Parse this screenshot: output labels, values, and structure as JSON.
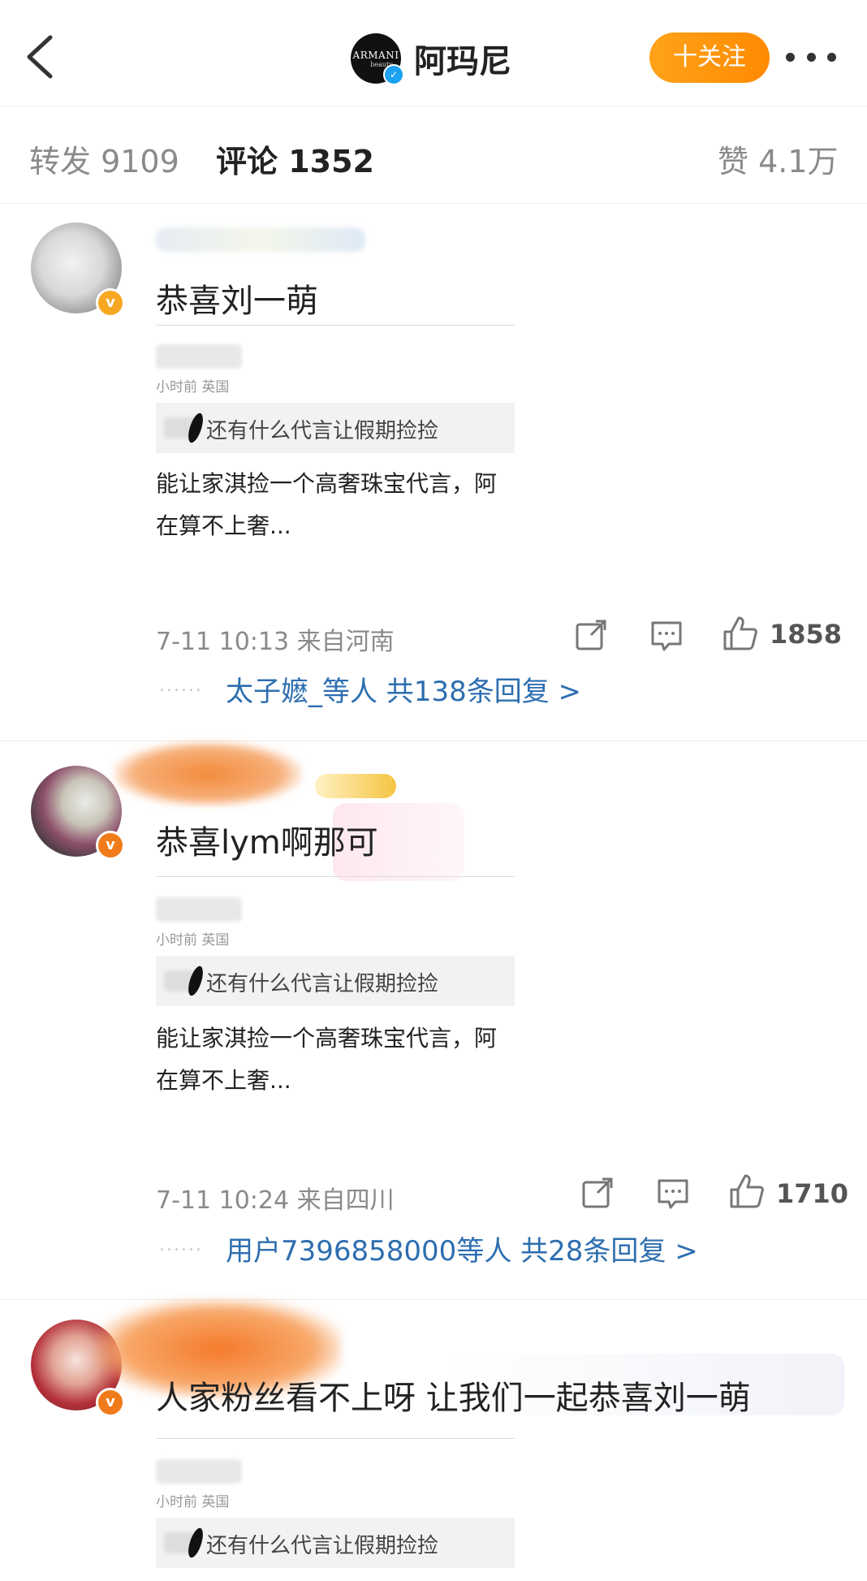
{
  "header": {
    "brand_logo_text": "ARMANI",
    "brand_logo_sub": "beauty",
    "brand_name": "阿玛尼",
    "follow_label": "十关注"
  },
  "tabs": {
    "repost": "转发 9109",
    "comments": "评论 1352",
    "likes": "赞 4.1万"
  },
  "comments": [
    {
      "text": "恭喜刘一萌",
      "embed_meta": "小时前 英国",
      "embed_bar": "还有什么代言让假期捡捡",
      "embed_body_1": "能让家淇捡一个高奢珠宝代言，阿",
      "embed_body_2": "在算不上奢...",
      "meta": "7-11 10:13  来自河南",
      "likes": "1858",
      "reply_link": "太子嬷_等人  共138条回复 >"
    },
    {
      "text": "恭喜lym啊那可",
      "embed_meta": "小时前 英国",
      "embed_bar": "还有什么代言让假期捡捡",
      "embed_body_1": "能让家淇捡一个高奢珠宝代言，阿",
      "embed_body_2": "在算不上奢...",
      "meta": "7-11 10:24  来自四川",
      "likes": "1710",
      "reply_link": "用户7396858000等人  共28条回复 >"
    },
    {
      "text": "人家粉丝看不上呀 让我们一起恭喜刘一萌",
      "embed_meta": "小时前 英国",
      "embed_bar": "还有什么代言让假期捡捡"
    }
  ],
  "colors": {
    "follow": "#ff9500",
    "link": "#2d6eb0",
    "badge_gold": "#f7a823",
    "badge_orange": "#f07b1a",
    "verified_blue": "#1da1f2"
  },
  "icons": [
    "back-icon",
    "more-icon",
    "repost-icon",
    "comment-icon",
    "like-icon",
    "verified-icon"
  ]
}
